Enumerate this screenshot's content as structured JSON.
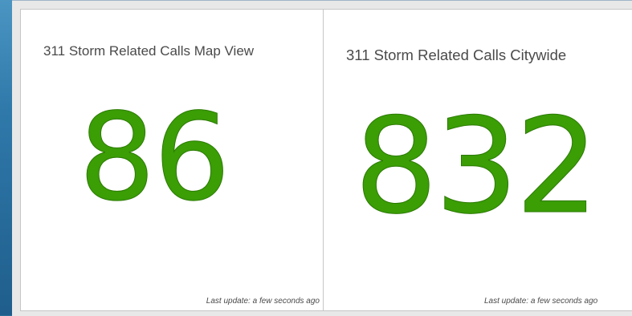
{
  "cards": [
    {
      "title": "311 Storm Related Calls Map View",
      "value": "86",
      "footer": "Last update: a few seconds ago"
    },
    {
      "title": "311 Storm Related Calls Citywide",
      "value": "832",
      "footer": "Last update: a few seconds ago"
    }
  ],
  "colors": {
    "value": "#3a9e04",
    "background": "#2b6f9a",
    "panel": "#e8e8e8",
    "card": "#ffffff"
  }
}
